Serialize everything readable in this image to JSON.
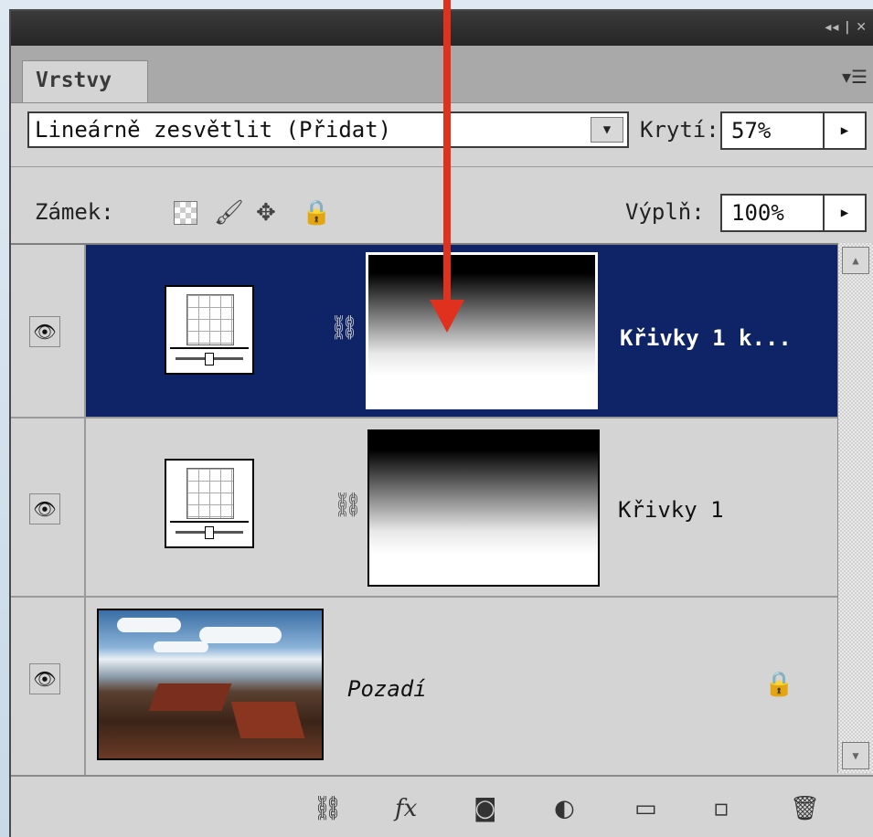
{
  "window": {
    "controls_text": "◂◂ | ✕"
  },
  "panel": {
    "tab_label": "Vrstvy",
    "menu_icon": "panel-menu-icon"
  },
  "blend": {
    "mode": "Lineárně zesvětlit (Přidat)"
  },
  "opacity": {
    "label": "Krytí:",
    "value": "57%"
  },
  "lock": {
    "label": "Zámek:"
  },
  "fill": {
    "label": "Výplň:",
    "value": "100%"
  },
  "layers": [
    {
      "name": "Křivky 1 k...",
      "selected": true,
      "type": "curves-adjustment"
    },
    {
      "name": "Křivky 1",
      "selected": false,
      "type": "curves-adjustment"
    },
    {
      "name": "Pozadí",
      "selected": false,
      "type": "background",
      "locked": true
    }
  ],
  "colors": {
    "selection": "#0e2466",
    "annotation_arrow": "#e0301e"
  }
}
